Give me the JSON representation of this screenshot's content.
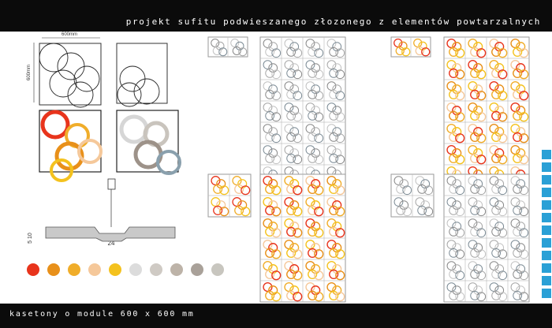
{
  "header": {
    "title": "projekt sufitu podwieszanego złozonego z elementów powtarzalnych"
  },
  "footer": {
    "caption": "kasetony o module 600 x 600 mm"
  },
  "dims": {
    "width_label": "600mm",
    "height_label": "600mm",
    "section_left": "5 10",
    "section_center": "24"
  },
  "palette": [
    "#e8341c",
    "#e8901a",
    "#f0ad2a",
    "#f5c89a",
    "#f4c21e",
    "#dcdcdc",
    "#cfcac4",
    "#bdb3a8",
    "#a9a199",
    "#c8c6bf"
  ],
  "accent": {
    "strip": "#2aa0d6",
    "line": "#7a7f86"
  }
}
